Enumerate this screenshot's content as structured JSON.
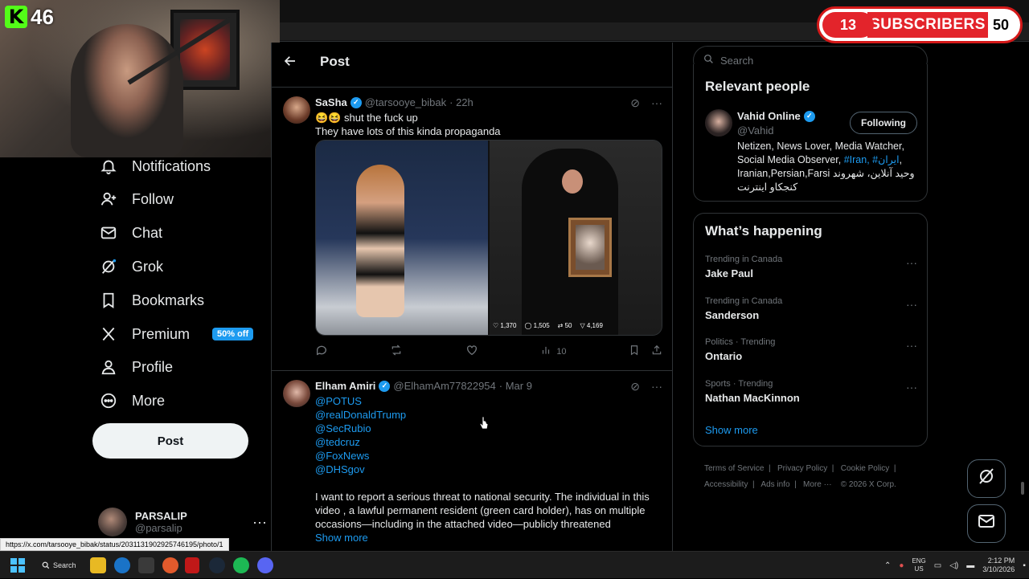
{
  "overlay": {
    "kick_count": "46",
    "subscribers": {
      "current": "13",
      "label": "SUBSCRIBERS",
      "goal": "50"
    }
  },
  "nav": {
    "items": [
      {
        "label": "Notifications",
        "icon": "bell-icon"
      },
      {
        "label": "Follow",
        "icon": "person-add-icon"
      },
      {
        "label": "Chat",
        "icon": "envelope-icon"
      },
      {
        "label": "Grok",
        "icon": "grok-icon"
      },
      {
        "label": "Bookmarks",
        "icon": "bookmark-icon"
      },
      {
        "label": "Premium",
        "icon": "x-logo-icon",
        "badge": "50% off"
      },
      {
        "label": "Profile",
        "icon": "person-icon"
      },
      {
        "label": "More",
        "icon": "more-circle-icon"
      }
    ],
    "post_button": "Post",
    "account": {
      "name": "PARSALIP",
      "handle": "@parsalip"
    }
  },
  "main": {
    "title": "Post",
    "tweets": [
      {
        "name": "SaSha",
        "handle": "@tarsooye_bibak",
        "time": "· 22h",
        "emoji": "😆😆",
        "lines": [
          "shut the fuck up",
          "They have lots of this kinda propaganda"
        ],
        "media_stats": {
          "likes": "1,370",
          "replies": "1,505",
          "reposts": "50",
          "views": "4,169"
        },
        "views": "10"
      },
      {
        "name": "Elham Amiri",
        "handle": "@ElhamAm77822954",
        "time": "· Mar 9",
        "mentions": [
          "@POTUS",
          "@realDonaldTrump",
          "@SecRubio",
          "@tedcruz",
          "@FoxNews",
          "@DHSgov"
        ],
        "text": "I want to report a serious threat to national security. The individual in this video , a lawful permanent resident (green card holder), has on multiple occasions—including in the attached video—publicly threatened",
        "show_more": "Show more"
      }
    ]
  },
  "sidebar": {
    "search_placeholder": "Search",
    "relevant": {
      "title": "Relevant people",
      "name": "Vahid Online",
      "handle": "@Vahid",
      "follow_label": "Following",
      "bio_pre": "Netizen, News Lover, Media Watcher, Social Media Observer, ",
      "tags": "#Iran, #ایران",
      "bio_post": ", Iranian,Persian,Farsi وحید آنلاین، شهروند کنجکاو اینترنت"
    },
    "happening": {
      "title": "What’s happening",
      "trends": [
        {
          "context": "Trending in Canada",
          "topic": "Jake Paul"
        },
        {
          "context": "Trending in Canada",
          "topic": "Sanderson"
        },
        {
          "context": "Politics · Trending",
          "topic": "Ontario"
        },
        {
          "context": "Sports · Trending",
          "topic": "Nathan MacKinnon"
        }
      ],
      "show_more": "Show more"
    },
    "footer": {
      "terms": "Terms of Service",
      "privacy": "Privacy Policy",
      "cookie": "Cookie Policy",
      "accessibility": "Accessibility",
      "ads": "Ads info",
      "more": "More ···",
      "copyright": "© 2026 X Corp."
    }
  },
  "status_url": "https://x.com/tarsooye_bibak/status/2031131902925746195/photo/1",
  "taskbar": {
    "search_label": "Search",
    "lang": "ENG",
    "region": "US",
    "time": "2:12 PM",
    "date": "3/10/2026"
  }
}
